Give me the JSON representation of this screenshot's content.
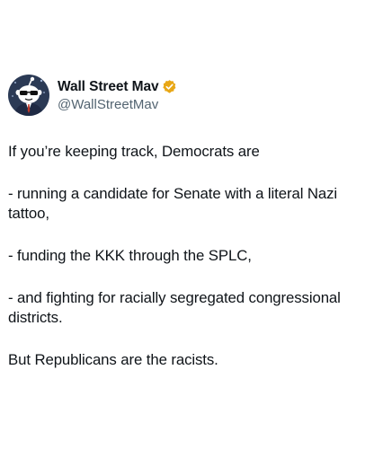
{
  "author": {
    "display_name": "Wall Street Mav",
    "handle": "@WallStreetMav",
    "verified": true,
    "verified_color": "#e8a716",
    "avatar_icon": "sunglasses-character-avatar"
  },
  "tweet": {
    "paragraphs": [
      "If you’re keeping track, Democrats are",
      "- running a candidate for Senate with a literal Nazi tattoo,",
      "- funding the KKK through the SPLC,",
      "- and fighting for racially segregated congressional districts.",
      "But Republicans are the racists."
    ]
  },
  "colors": {
    "text_primary": "#0f1419",
    "text_secondary": "#536471",
    "avatar_background": "#2b3a55"
  }
}
